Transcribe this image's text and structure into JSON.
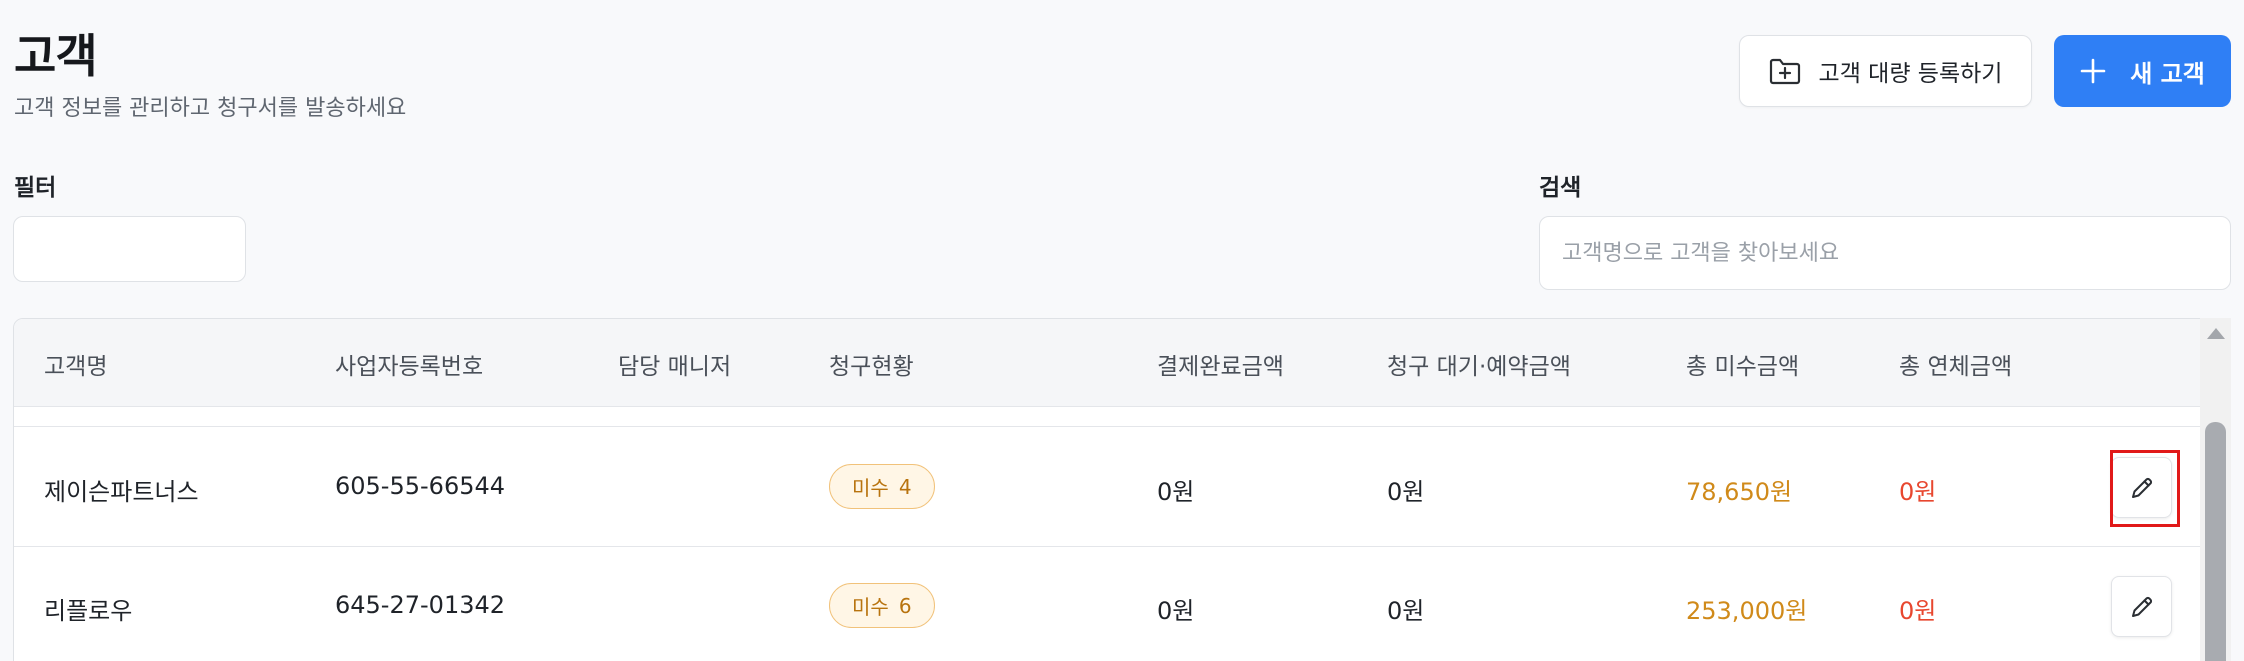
{
  "header": {
    "title": "고객",
    "subtitle": "고객 정보를 관리하고 청구서를 발송하세요",
    "bulk_button_label": "고객 대량 등록하기",
    "bulk_button_icon": "folder-plus-icon",
    "new_button_label": "새 고객",
    "new_button_icon": "plus-icon"
  },
  "filters": {
    "filter_label": "필터",
    "filter_value": "",
    "search_label": "검색",
    "search_placeholder": "고객명으로 고객을 찾아보세요",
    "search_value": ""
  },
  "table": {
    "columns": [
      "고객명",
      "사업자등록번호",
      "담당 매니저",
      "청구현황",
      "결제완료금액",
      "청구 대기·예약금액",
      "총 미수금액",
      "총 연체금액"
    ],
    "rows": [
      {
        "name": "제이슨파트너스",
        "business_number": "605-55-66544",
        "manager": "",
        "status_label": "미수",
        "status_count": "4",
        "paid": "0원",
        "pending": "0원",
        "unpaid": "78,650원",
        "overdue": "0원"
      },
      {
        "name": "리플로우",
        "business_number": "645-27-01342",
        "manager": "",
        "status_label": "미수",
        "status_count": "6",
        "paid": "0원",
        "pending": "0원",
        "unpaid": "253,000원",
        "overdue": "0원"
      }
    ],
    "edit_icon": "pencil-icon"
  },
  "colors": {
    "primary": "#2f7ff5",
    "unpaid": "#d08a1a",
    "overdue": "#e8472f",
    "badge_border": "#f1c27a",
    "badge_bg": "#fff6e6",
    "highlight": "#e11919"
  }
}
